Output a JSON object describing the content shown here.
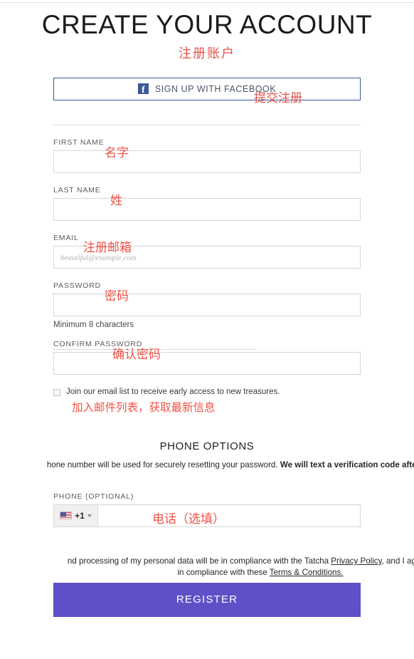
{
  "header": {
    "title": "CREATE YOUR ACCOUNT",
    "title_cn": "注册账户"
  },
  "social": {
    "facebook_label": "SIGN UP WITH FACEBOOK",
    "facebook_icon": "facebook-icon",
    "facebook_brand_color": "#3b5998"
  },
  "form": {
    "first_name": {
      "label": "FIRST NAME",
      "value": "",
      "placeholder": "",
      "annotation_cn": "名字"
    },
    "last_name": {
      "label": "LAST NAME",
      "value": "",
      "placeholder": "",
      "annotation_cn": "姓"
    },
    "email": {
      "label": "EMAIL",
      "value": "",
      "placeholder": "beautiful@example.com",
      "annotation_cn": "注册邮箱"
    },
    "password": {
      "label": "PASSWORD",
      "value": "",
      "placeholder": "",
      "helper": "Minimum 8 characters",
      "annotation_cn": "密码"
    },
    "confirm_password": {
      "label": "CONFIRM PASSWORD",
      "value": "",
      "placeholder": "",
      "annotation_cn": "确认密码"
    },
    "newsletter": {
      "label": "Join our email list to receive early access to new treasures.",
      "checked": false,
      "annotation_cn": "加入邮件列表，获取最新信息"
    }
  },
  "phone_section": {
    "heading": "PHONE OPTIONS",
    "description_part1": "hone number will be used for securely resetting your password.",
    "description_bold": "We will text a verification code after you Register.",
    "field": {
      "label": "PHONE (OPTIONAL)",
      "country_code": "+1",
      "country_flag": "us-flag-icon",
      "value": "",
      "placeholder": "",
      "annotation_cn": "电话（选填）"
    }
  },
  "legal": {
    "text_before_privacy": "nd processing of my personal data will be in compliance with the Tatcha ",
    "privacy_link": "Privacy Policy",
    "text_after_privacy": ", and I agree that m",
    "line2_before": "in compliance with these ",
    "terms_link": "Terms & Conditions."
  },
  "submit": {
    "label": "REGISTER",
    "annotation_cn": "提交注册",
    "color": "#6050c8"
  }
}
